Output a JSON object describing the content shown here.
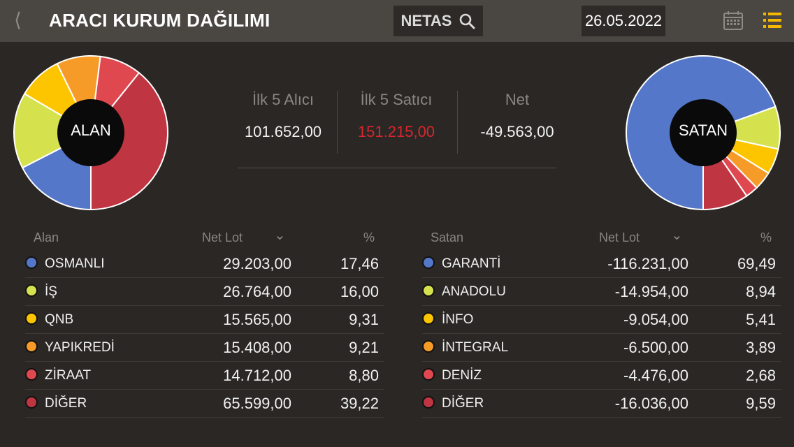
{
  "header": {
    "back_glyph": "⟨",
    "title": "ARACI KURUM DAĞILIMI",
    "search_symbol": "NETAS",
    "date": "26.05.2022"
  },
  "icons": [
    "back-icon",
    "search-icon",
    "calendar-icon",
    "list-menu-icon"
  ],
  "colors": {
    "blue": "#5577c9",
    "lime": "#d6e24d",
    "yellow": "#fcc500",
    "orange": "#f69a28",
    "red": "#e04850",
    "darkred": "#c03542",
    "negative": "#d8262e"
  },
  "pies": {
    "alan_label": "ALAN",
    "satan_label": "SATAN"
  },
  "summary": {
    "buyers_label": "İlk 5 Alıcı",
    "buyers_value": "101.652,00",
    "sellers_label": "İlk 5 Satıcı",
    "sellers_value": "151.215,00",
    "net_label": "Net",
    "net_value": "-49.563,00"
  },
  "alan_table": {
    "headers": {
      "name": "Alan",
      "lot": "Net Lot",
      "sort": "⌄",
      "pct": "%"
    },
    "rows": [
      {
        "name": "OSMANLI",
        "lot": "29.203,00",
        "pct": "17,46",
        "color": "#5577c9",
        "pct_value": 17.46
      },
      {
        "name": "İŞ",
        "lot": "26.764,00",
        "pct": "16,00",
        "color": "#d6e24d",
        "pct_value": 16.0
      },
      {
        "name": "QNB",
        "lot": "15.565,00",
        "pct": "9,31",
        "color": "#fcc500",
        "pct_value": 9.31
      },
      {
        "name": "YAPIKREDİ",
        "lot": "15.408,00",
        "pct": "9,21",
        "color": "#f69a28",
        "pct_value": 9.21
      },
      {
        "name": "ZİRAAT",
        "lot": "14.712,00",
        "pct": "8,80",
        "color": "#e04850",
        "pct_value": 8.8
      },
      {
        "name": "DİĞER",
        "lot": "65.599,00",
        "pct": "39,22",
        "color": "#c03542",
        "pct_value": 39.22
      }
    ]
  },
  "satan_table": {
    "headers": {
      "name": "Satan",
      "lot": "Net Lot",
      "sort": "⌄",
      "pct": "%"
    },
    "rows": [
      {
        "name": "GARANTİ",
        "lot": "-116.231,00",
        "pct": "69,49",
        "color": "#5577c9",
        "pct_value": 69.49
      },
      {
        "name": "ANADOLU",
        "lot": "-14.954,00",
        "pct": "8,94",
        "color": "#d6e24d",
        "pct_value": 8.94
      },
      {
        "name": "İNFO",
        "lot": "-9.054,00",
        "pct": "5,41",
        "color": "#fcc500",
        "pct_value": 5.41
      },
      {
        "name": "İNTEGRAL",
        "lot": "-6.500,00",
        "pct": "3,89",
        "color": "#f69a28",
        "pct_value": 3.89
      },
      {
        "name": "DENİZ",
        "lot": "-4.476,00",
        "pct": "2,68",
        "color": "#e04850",
        "pct_value": 2.68
      },
      {
        "name": "DİĞER",
        "lot": "-16.036,00",
        "pct": "9,59",
        "color": "#c03542",
        "pct_value": 9.59
      }
    ]
  }
}
